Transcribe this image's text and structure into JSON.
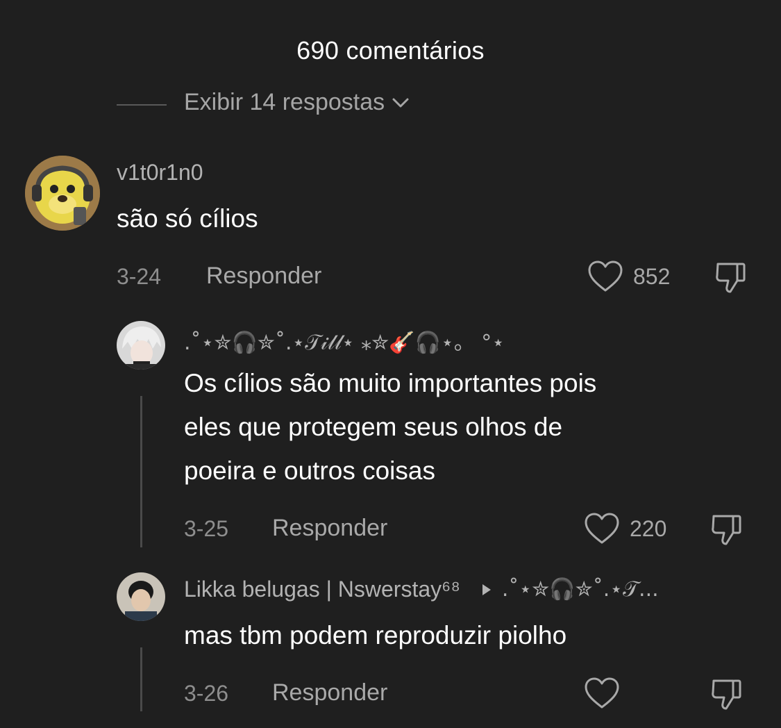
{
  "header": {
    "title": "690 comentários"
  },
  "view_replies": {
    "label": "Exibir 14 respostas"
  },
  "comments": [
    {
      "username": "v1t0r1n0",
      "text": "são só cílios",
      "date": "3-24",
      "reply_label": "Responder",
      "likes": "852",
      "avatar": "cartoon-dog-with-headphones"
    },
    {
      "username": ".˚⋆✮🎧✮˚.⋆𝒯𝒾𝓁𝓁⋆ ⁎✮🎸🎧⋆。 °⋆",
      "text_lines": [
        "Os cílios são muito importantes pois",
        "eles que protegem seus olhos de",
        "poeira e outros coisas"
      ],
      "date": "3-25",
      "reply_label": "Responder",
      "likes": "220",
      "avatar": "anime-silver-hair"
    },
    {
      "username": "Likka belugas | Nswerstay⁶⁸",
      "reply_to": ".˚⋆✮🎧✮˚.⋆𝒯...",
      "text": "mas tbm podem reproduzir piolho",
      "date": "3-26",
      "reply_label": "Responder",
      "likes": "",
      "avatar": "person-photo"
    }
  ],
  "icons": {
    "like": "heart-outline-icon",
    "dislike": "thumbs-down-icon",
    "expand": "chevron-down-icon",
    "reply_arrow": "triangle-right-icon"
  },
  "colors": {
    "background": "#1f1f1f",
    "text_primary": "#ffffff",
    "text_secondary": "#a9a9a9"
  }
}
